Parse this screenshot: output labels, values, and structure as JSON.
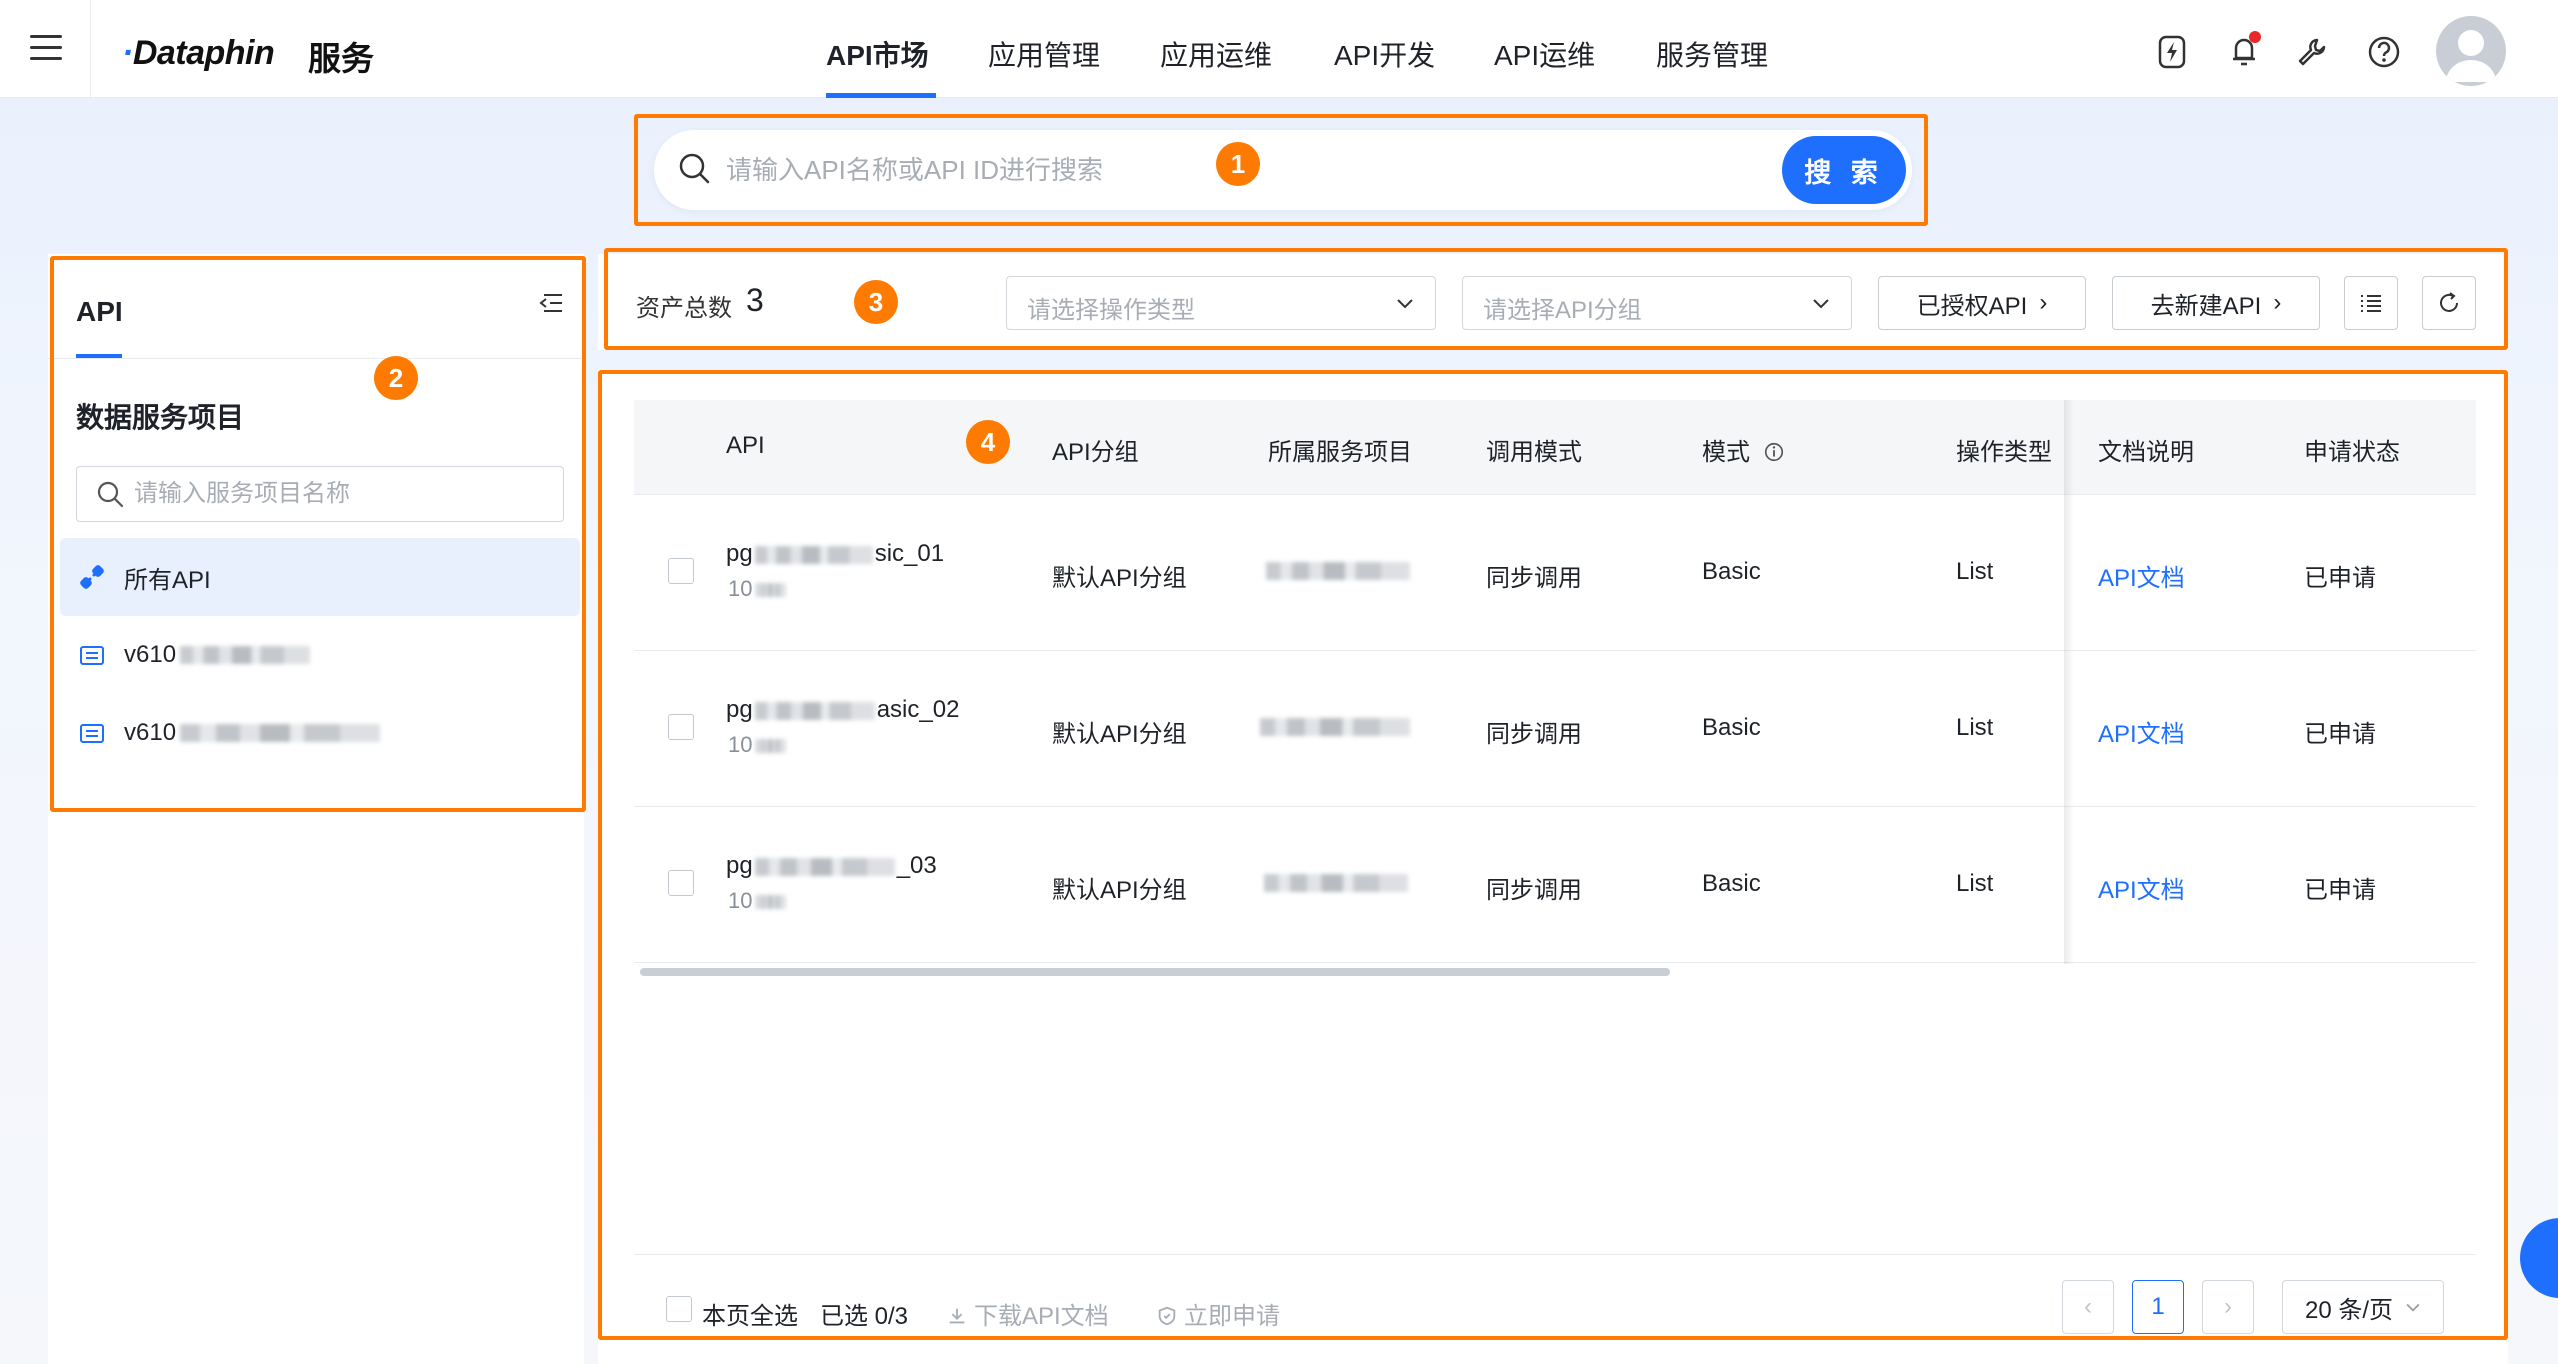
{
  "topbar": {
    "brand": "Dataphin",
    "brand_sub": "服务",
    "nav_tabs": [
      "API市场",
      "应用管理",
      "应用运维",
      "API开发",
      "API运维",
      "服务管理"
    ],
    "active_tab": "API市场"
  },
  "search": {
    "placeholder": "请输入API名称或API ID进行搜索",
    "button_label": "搜 索"
  },
  "sidebar": {
    "tab_label": "API",
    "section_title": "数据服务项目",
    "search_placeholder": "请输入服务项目名称",
    "items": [
      {
        "label": "所有API",
        "icon": "link-icon",
        "active": true
      },
      {
        "label": "v610",
        "icon": "folder-icon",
        "active": false
      },
      {
        "label": "v610",
        "icon": "folder-icon",
        "active": false
      }
    ]
  },
  "filters": {
    "asset_label": "资产总数",
    "asset_count": "3",
    "operation_type_placeholder": "请选择操作类型",
    "api_group_placeholder": "请选择API分组",
    "authorized_button": "已授权API",
    "create_button": "去新建API"
  },
  "table": {
    "columns": [
      "API",
      "API分组",
      "所属服务项目",
      "调用模式",
      "模式",
      "操作类型",
      "文档说明",
      "申请状态"
    ],
    "rows": [
      {
        "name_prefix": "pg",
        "name_suffix": "sic_01",
        "id_prefix": "10",
        "group": "默认API分组",
        "call_mode": "同步调用",
        "mode": "Basic",
        "op_type": "List",
        "doc": "API文档",
        "status": "已申请"
      },
      {
        "name_prefix": "pg",
        "name_suffix": "asic_02",
        "id_prefix": "10",
        "group": "默认API分组",
        "call_mode": "同步调用",
        "mode": "Basic",
        "op_type": "List",
        "doc": "API文档",
        "status": "已申请"
      },
      {
        "name_prefix": "pg",
        "name_suffix": "_03",
        "id_prefix": "10",
        "group": "默认API分组",
        "call_mode": "同步调用",
        "mode": "Basic",
        "op_type": "List",
        "doc": "API文档",
        "status": "已申请"
      }
    ]
  },
  "footer": {
    "select_all": "本页全选",
    "selected": "已选 0/3",
    "download": "下载API文档",
    "apply": "立即申请",
    "current_page": "1",
    "page_size": "20 条/页"
  },
  "annotations": [
    "1",
    "2",
    "3",
    "4"
  ],
  "colors": {
    "accent": "#1f6fff",
    "annotation": "#ff7a00"
  }
}
